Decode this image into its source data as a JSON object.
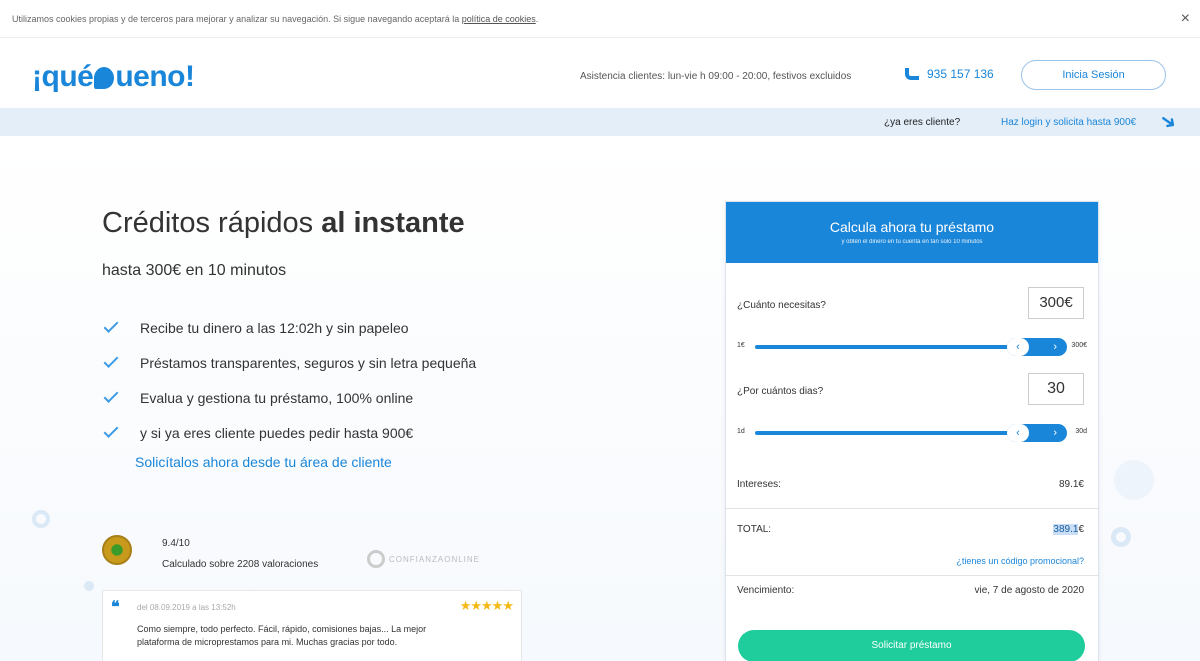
{
  "cookie": {
    "text": "Utilizamos cookies propias y de terceros para mejorar y analizar su navegación. Si sigue navegando aceptará la ",
    "link": "política de cookies",
    "suffix": ".",
    "close": "×"
  },
  "header": {
    "logo_pre": "¡qué",
    "logo_post": "ueno!",
    "assistance": "Asistencia clientes: lun-vie h 09:00 - 20:00, festivos excluidos",
    "phone": "935 157 136",
    "login_label": "Inicia Sesión"
  },
  "subbar": {
    "question": "¿ya eres cliente?",
    "link": "Haz login y solicita hasta 900€"
  },
  "hero": {
    "title_light": "Créditos rápidos ",
    "title_bold": "al instante",
    "subtitle": "hasta 300€ en 10 minutos",
    "features": [
      "Recibe tu dinero a las 12:02h y sin papeleo",
      "Préstamos transparentes, seguros y sin letra pequeña",
      "Evalua y gestiona tu préstamo, 100% online",
      "y si ya eres cliente puedes pedir hasta 900€"
    ],
    "cta_link": "Solicítalos ahora desde tu área de cliente"
  },
  "rating": {
    "score": "9.4/10",
    "count": "Calculado sobre 2208 valoraciones",
    "confianza": "CONFIANZAONLINE"
  },
  "review": {
    "date": "del 08.09.2019 a las 13:52h",
    "stars": "★★★★★",
    "rating": 5,
    "text": "Como siempre, todo perfecto. Fácil, rápido, comisiones bajas... La mejor plataforma de microprestamos para mi. Muchas gracias por todo."
  },
  "calculator": {
    "title": "Calcula ahora tu préstamo",
    "subtitle": "y obtén el dinero en tu cuenta en tan solo 10 minutos",
    "amount_label": "¿Cuánto necesitas?",
    "amount_value": "300€",
    "amount_min": "1€",
    "amount_max": "300€",
    "amount_fraction": 1.0,
    "days_label": "¿Por cuántos dias?",
    "days_value": "30",
    "days_min": "1d",
    "days_max": "30d",
    "days_fraction": 1.0,
    "interest_label": "Intereses:",
    "interest_value": "89.1€",
    "total_label": "TOTAL:",
    "total_value_num": "389.1",
    "total_value_unit": "€",
    "promo_link": "¿tienes un código promocional?",
    "due_label": "Vencimiento:",
    "due_value": "vie, 7 de agosto de 2020",
    "submit_label": "Solicitar préstamo"
  },
  "colors": {
    "brand": "#1a86d9",
    "cta": "#1fcc9b",
    "star": "#f5b915"
  }
}
